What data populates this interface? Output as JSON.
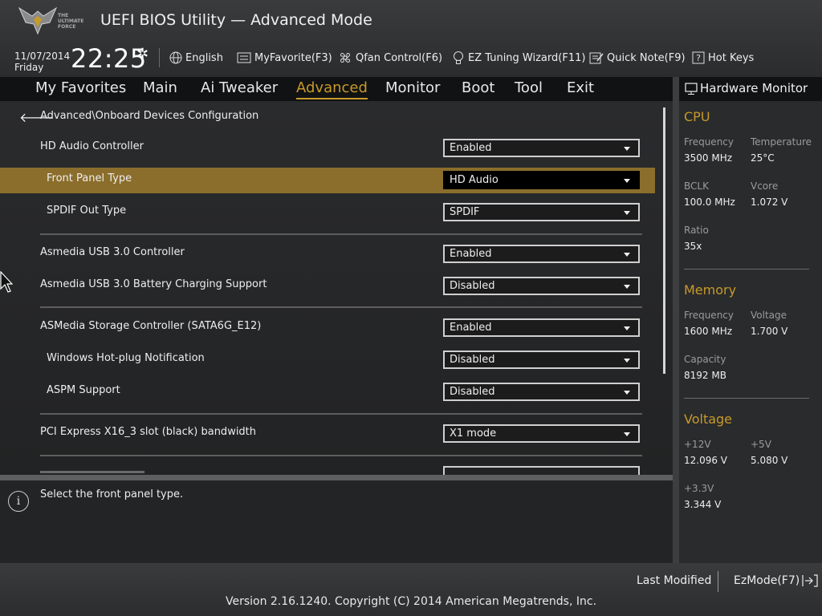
{
  "header": {
    "title": "UEFI BIOS Utility — Advanced Mode",
    "logo_text": [
      "THE",
      "ULTIMATE",
      "FORCE"
    ],
    "date": "11/07/2014",
    "day": "Friday",
    "time": "22:25",
    "tools": {
      "language": "English",
      "myfavorite": "MyFavorite(F3)",
      "qfan": "Qfan Control(F6)",
      "ez_tuning": "EZ Tuning Wizard(F11)",
      "quick_note": "Quick Note(F9)",
      "hot_keys": "Hot Keys"
    }
  },
  "nav": {
    "tabs": [
      "My Favorites",
      "Main",
      "Ai Tweaker",
      "Advanced",
      "Monitor",
      "Boot",
      "Tool",
      "Exit"
    ],
    "active": "Advanced"
  },
  "main": {
    "breadcrumb": "Advanced\\Onboard Devices Configuration",
    "settings": [
      {
        "label": "HD Audio Controller",
        "value": "Enabled"
      },
      {
        "label": "Front Panel Type",
        "value": "HD Audio",
        "selected": true
      },
      {
        "label": "SPDIF Out Type",
        "value": "SPDIF"
      },
      {
        "label": "Asmedia USB 3.0 Controller",
        "value": "Enabled"
      },
      {
        "label": "Asmedia USB 3.0 Battery Charging Support",
        "value": "Disabled"
      },
      {
        "label": "ASMedia Storage Controller (SATA6G_E12)",
        "value": "Enabled"
      },
      {
        "label": "Windows Hot-plug Notification",
        "value": "Disabled"
      },
      {
        "label": "ASPM Support",
        "value": "Disabled"
      },
      {
        "label": "PCI Express X16_3 slot (black) bandwidth",
        "value": "X1 mode"
      }
    ]
  },
  "help": {
    "text": "Select the front panel type."
  },
  "hardware_monitor": {
    "title": "Hardware Monitor",
    "cpu": {
      "heading": "CPU",
      "frequency_label": "Frequency",
      "frequency": "3500 MHz",
      "temperature_label": "Temperature",
      "temperature": "25°C",
      "bclk_label": "BCLK",
      "bclk": "100.0 MHz",
      "vcore_label": "Vcore",
      "vcore": "1.072 V",
      "ratio_label": "Ratio",
      "ratio": "35x"
    },
    "memory": {
      "heading": "Memory",
      "frequency_label": "Frequency",
      "frequency": "1600 MHz",
      "voltage_label": "Voltage",
      "voltage": "1.700 V",
      "capacity_label": "Capacity",
      "capacity": "8192 MB"
    },
    "voltage": {
      "heading": "Voltage",
      "v12_label": "+12V",
      "v12": "12.096 V",
      "v5_label": "+5V",
      "v5": "5.080 V",
      "v33_label": "+3.3V",
      "v33": "3.344 V"
    }
  },
  "footer": {
    "last_modified": "Last Modified",
    "ezmode": "EzMode(F7)",
    "copyright": "Version 2.16.1240. Copyright (C) 2014 American Megatrends, Inc."
  },
  "colors": {
    "accent": "#c79a2a",
    "highlight_row": "#8b6e2c"
  }
}
